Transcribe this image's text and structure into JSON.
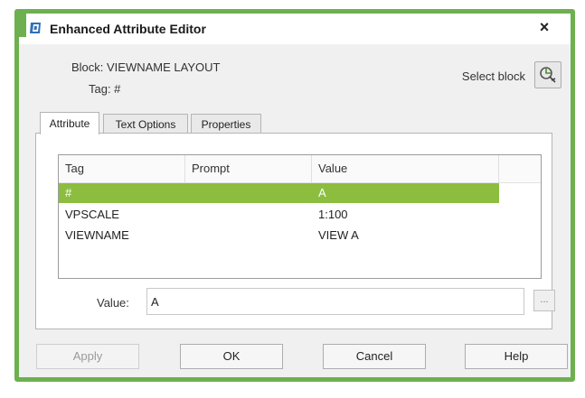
{
  "window": {
    "title": "Enhanced Attribute Editor",
    "close_label": "×",
    "accent_color": "#6db04f"
  },
  "header": {
    "block_label": "Block: VIEWNAME LAYOUT",
    "tag_label": "Tag: #",
    "select_block_label": "Select block",
    "select_block_icon": "select-object-icon"
  },
  "tabs": [
    {
      "label": "Attribute",
      "active": true
    },
    {
      "label": "Text Options",
      "active": false
    },
    {
      "label": "Properties",
      "active": false
    }
  ],
  "attribute_list": {
    "columns": [
      "Tag",
      "Prompt",
      "Value"
    ],
    "rows": [
      {
        "tag": "#",
        "prompt": "",
        "value": "A",
        "selected": true
      },
      {
        "tag": "VPSCALE",
        "prompt": "",
        "value": "1:100",
        "selected": false
      },
      {
        "tag": "VIEWNAME",
        "prompt": "",
        "value": "VIEW A",
        "selected": false
      }
    ],
    "selected_color": "#8cbd3f"
  },
  "value_field": {
    "label": "Value:",
    "value": "A",
    "browse_label": "..."
  },
  "buttons": {
    "apply": "Apply",
    "ok": "OK",
    "cancel": "Cancel",
    "help": "Help"
  }
}
